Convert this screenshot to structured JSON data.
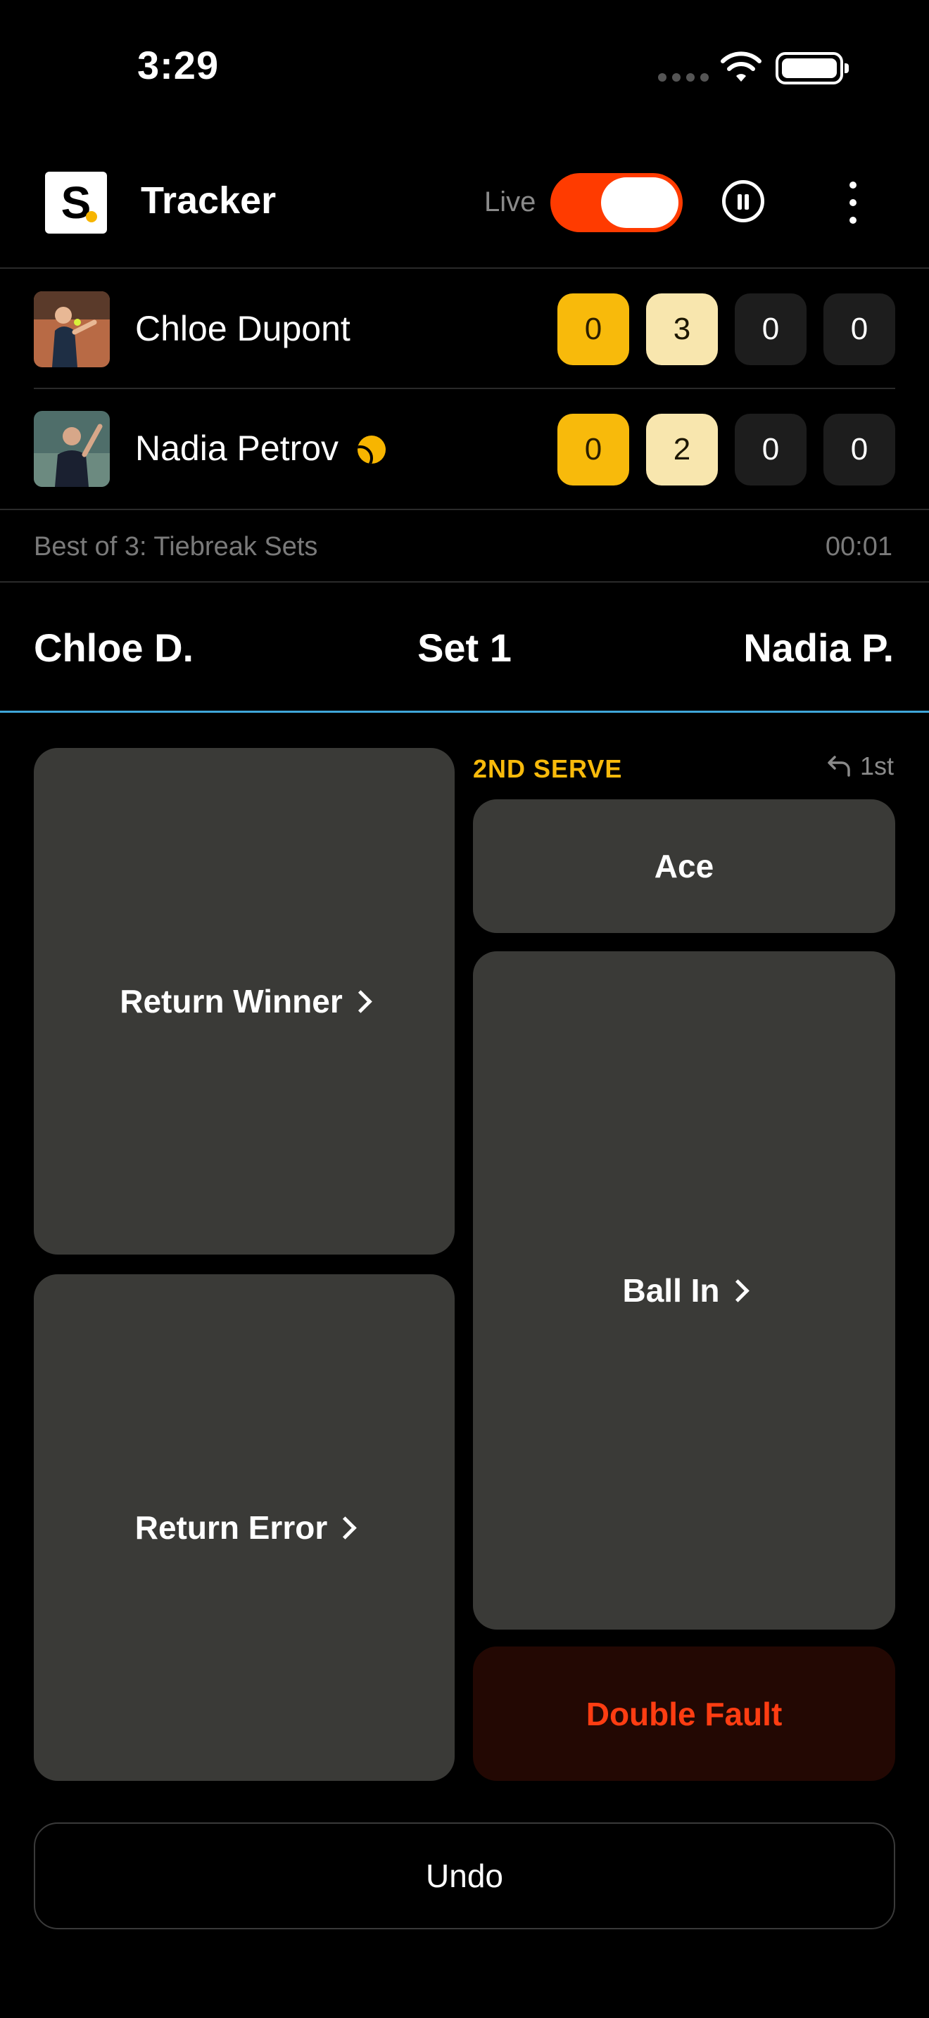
{
  "status_bar": {
    "time": "3:29"
  },
  "header": {
    "logo_letter": "S",
    "title": "Tracker",
    "live_label": "Live",
    "live_on": true,
    "accent_color": "#ff3b00"
  },
  "players": [
    {
      "name": "Chloe Dupont",
      "serving": false,
      "scores": [
        "0",
        "3",
        "0",
        "0"
      ]
    },
    {
      "name": "Nadia Petrov",
      "serving": true,
      "scores": [
        "0",
        "2",
        "0",
        "0"
      ]
    }
  ],
  "match": {
    "format": "Best of 3: Tiebreak Sets",
    "elapsed": "00:01"
  },
  "set_bar": {
    "left_player": "Chloe D.",
    "set": "Set 1",
    "right_player": "Nadia P."
  },
  "serve": {
    "label": "2ND SERVE",
    "back_label": "1st"
  },
  "actions": {
    "return_winner": "Return Winner",
    "return_error": "Return Error",
    "ace": "Ace",
    "ball_in": "Ball In",
    "double_fault": "Double Fault",
    "undo": "Undo"
  },
  "colors": {
    "games_highlight": "#f8ba0b",
    "points_highlight": "#f8e6ae",
    "panel": "#3a3a37",
    "fault_text": "#ff3d12",
    "divider_accent": "#3fa6d9"
  }
}
